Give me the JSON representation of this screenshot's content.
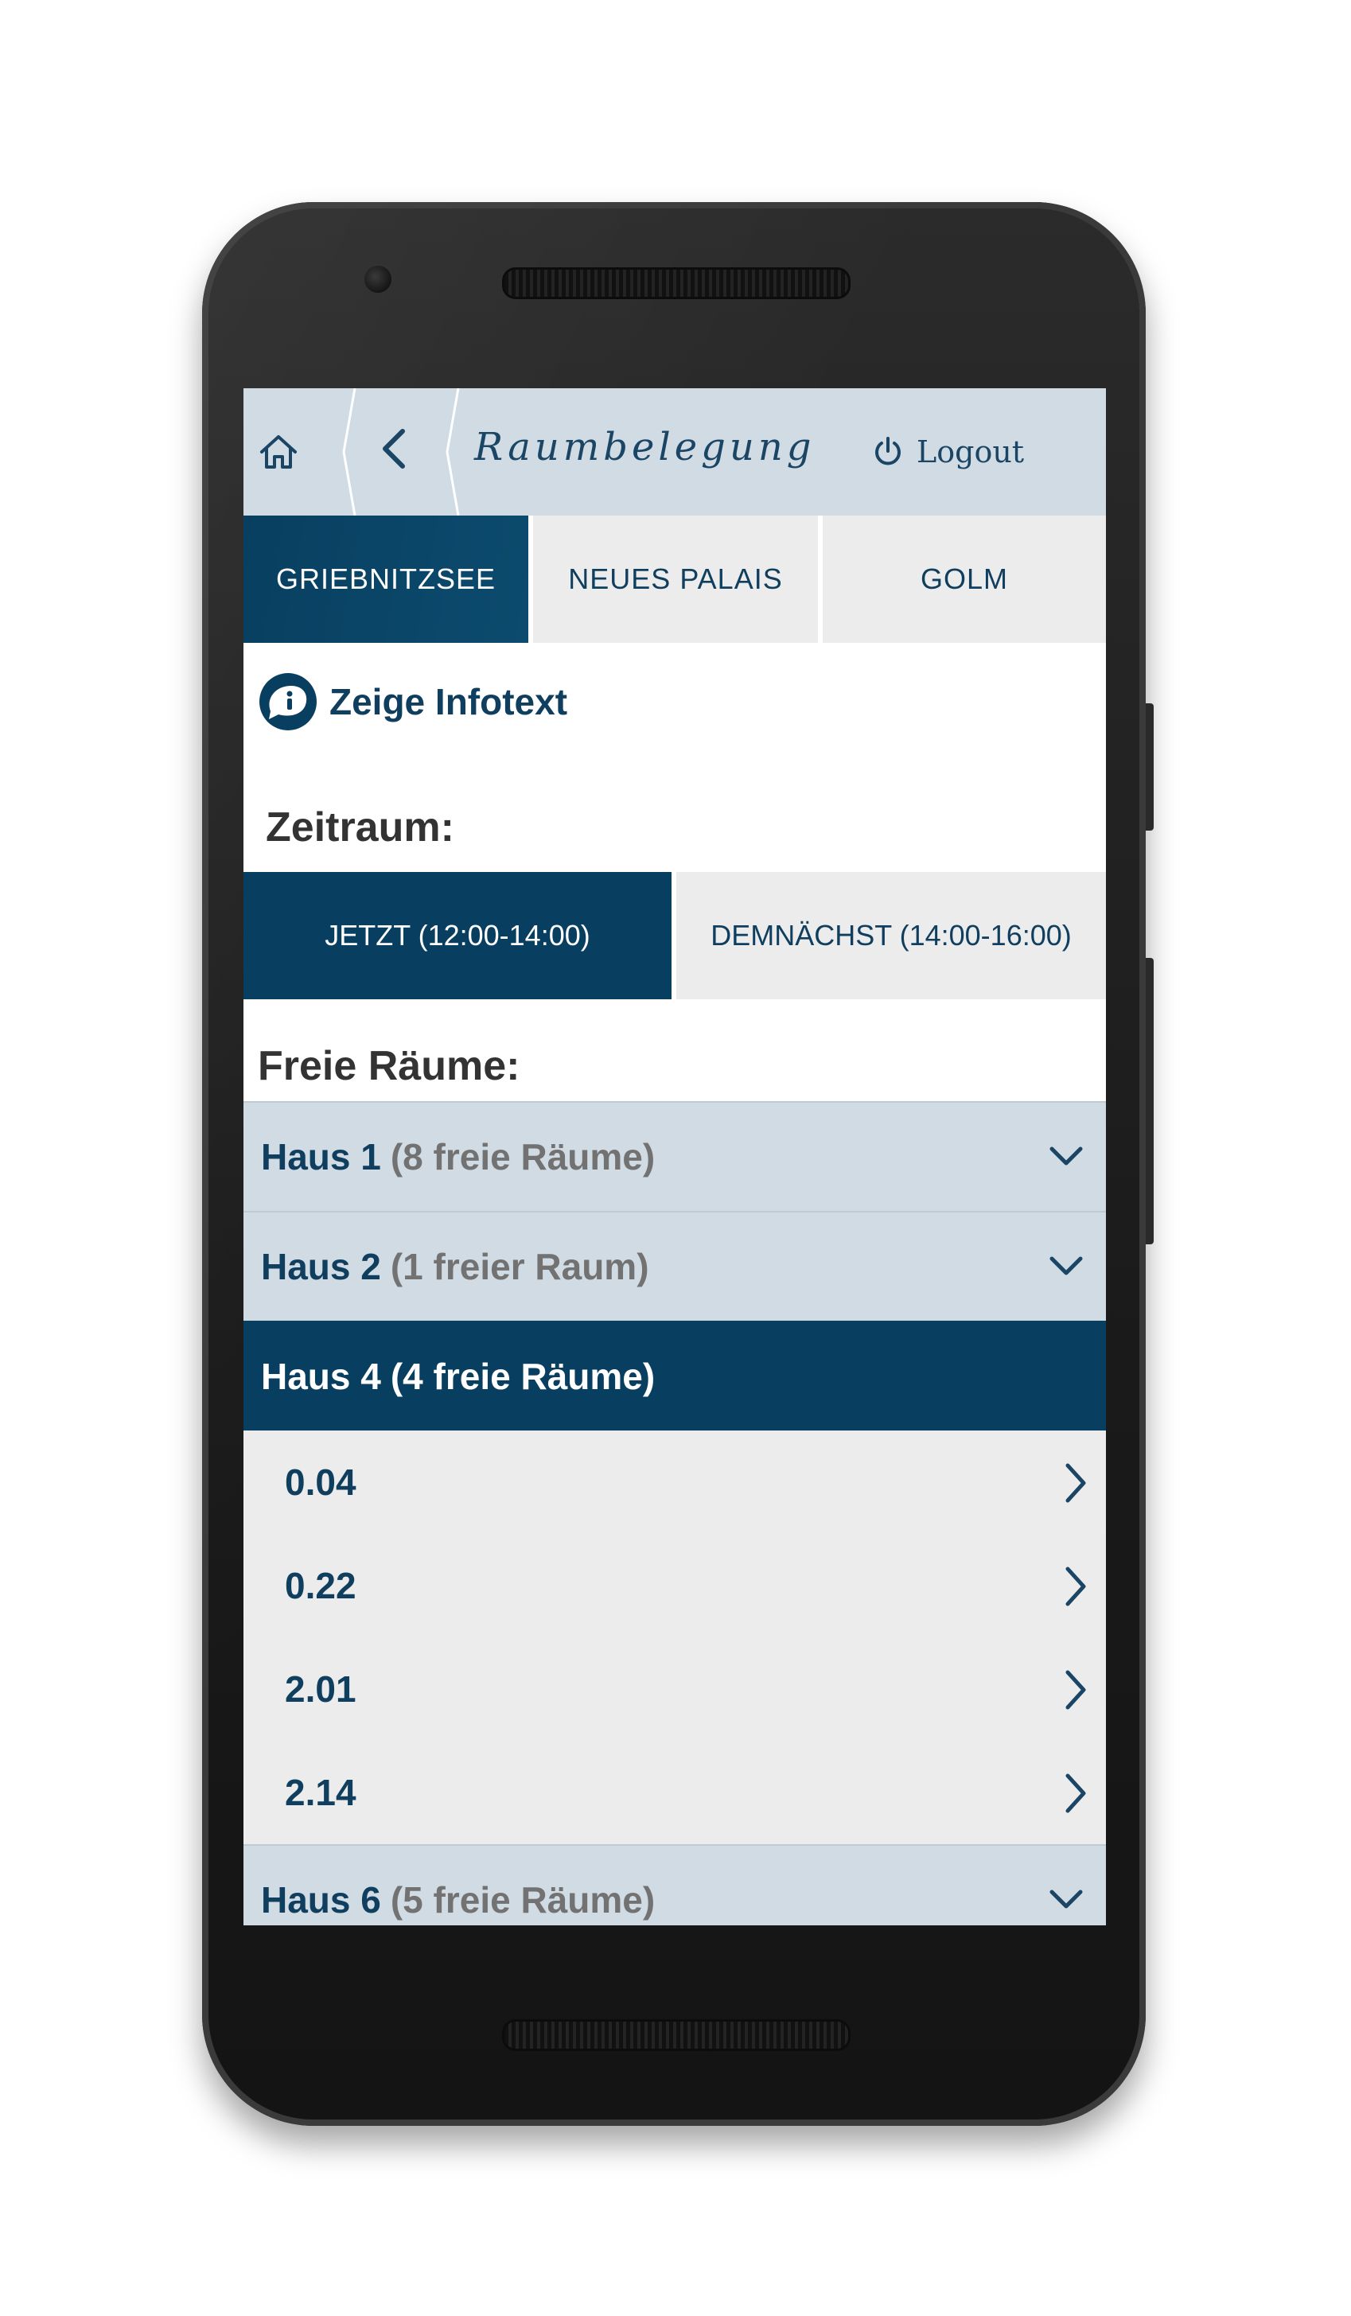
{
  "header": {
    "home_icon": "home-icon",
    "back_icon": "chevron-left-icon",
    "title": "Raumbelegung",
    "logout_icon": "power-icon",
    "logout_label": "Logout"
  },
  "campus_tabs": [
    {
      "label": "GRIEBNITZSEE",
      "selected": true
    },
    {
      "label": "NEUES PALAIS",
      "selected": false
    },
    {
      "label": "GOLM",
      "selected": false
    }
  ],
  "info": {
    "icon": "info-bubble-icon",
    "label": "Zeige Infotext"
  },
  "zeitraum": {
    "label": "Zeitraum:",
    "options": [
      {
        "label": "JETZT (12:00-14:00)",
        "selected": true
      },
      {
        "label": "DEMNÄCHST (14:00-16:00)",
        "selected": false
      }
    ]
  },
  "free_rooms": {
    "label": "Freie Räume:",
    "houses": [
      {
        "name": "Haus 1",
        "count": "(8 freie Räume)",
        "expanded": false
      },
      {
        "name": "Haus 2",
        "count": "(1 freier Raum)",
        "expanded": false
      },
      {
        "name": "Haus 4",
        "count": "(4 freie Räume)",
        "expanded": true,
        "rooms": [
          "0.04",
          "0.22",
          "2.01",
          "2.14"
        ]
      },
      {
        "name": "Haus 6",
        "count": "(5 freie Räume)",
        "expanded": false
      }
    ]
  },
  "colors": {
    "primary": "#083f60",
    "header_bg": "#d0dbe3",
    "tab_bg": "#ececec",
    "text_dark": "#333333",
    "text_muted": "#727272"
  }
}
